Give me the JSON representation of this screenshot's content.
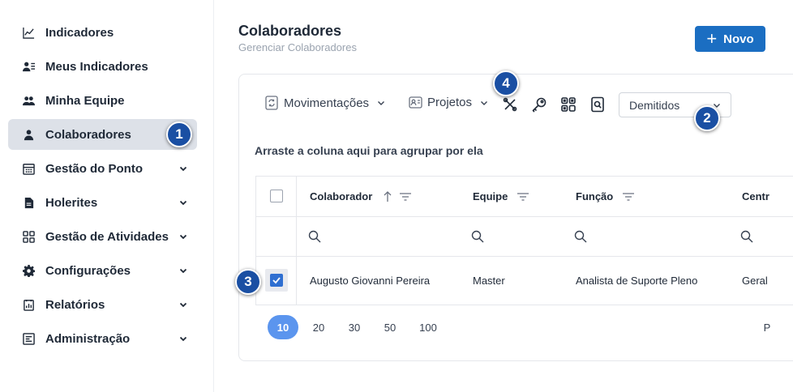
{
  "sidebar": {
    "items": [
      {
        "label": "Indicadores",
        "icon": "chart-line-icon",
        "expandable": false,
        "active": false
      },
      {
        "label": "Meus Indicadores",
        "icon": "user-list-icon",
        "expandable": false,
        "active": false
      },
      {
        "label": "Minha Equipe",
        "icon": "users-icon",
        "expandable": false,
        "active": false
      },
      {
        "label": "Colaboradores",
        "icon": "user-icon",
        "expandable": false,
        "active": true
      },
      {
        "label": "Gestão do Ponto",
        "icon": "calendar-icon",
        "expandable": true,
        "active": false
      },
      {
        "label": "Holerites",
        "icon": "document-icon",
        "expandable": true,
        "active": false
      },
      {
        "label": "Gestão de Atividades",
        "icon": "grid-icon",
        "expandable": true,
        "active": false
      },
      {
        "label": "Configurações",
        "icon": "gear-icon",
        "expandable": true,
        "active": false
      },
      {
        "label": "Relatórios",
        "icon": "report-icon",
        "expandable": true,
        "active": false
      },
      {
        "label": "Administração",
        "icon": "admin-list-icon",
        "expandable": true,
        "active": false
      }
    ]
  },
  "header": {
    "title": "Colaboradores",
    "subtitle": "Gerenciar Colaboradores",
    "new_button": "Novo"
  },
  "toolbar": {
    "movimentacoes": "Movimentações",
    "projetos": "Projetos",
    "status_filter": "Demitidos"
  },
  "grid": {
    "group_hint": "Arraste a coluna aqui para agrupar por ela",
    "columns": [
      "Colaborador",
      "Equipe",
      "Função",
      "Centr"
    ],
    "rows": [
      {
        "colaborador": "Augusto Giovanni Pereira",
        "equipe": "Master",
        "funcao": "Analista de Suporte Pleno",
        "centro": "Geral",
        "selected": true
      }
    ],
    "page_sizes": [
      "10",
      "20",
      "30",
      "50",
      "100"
    ],
    "active_page_size": "10",
    "pager_info": "P"
  },
  "badges": [
    "1",
    "2",
    "3",
    "4"
  ],
  "colors": {
    "accent": "#1b6ec2",
    "badge": "#1a4fa3",
    "active_nav": "#dde1e8",
    "checkbox": "#2f6fd1",
    "page_active": "#5b95ee"
  }
}
